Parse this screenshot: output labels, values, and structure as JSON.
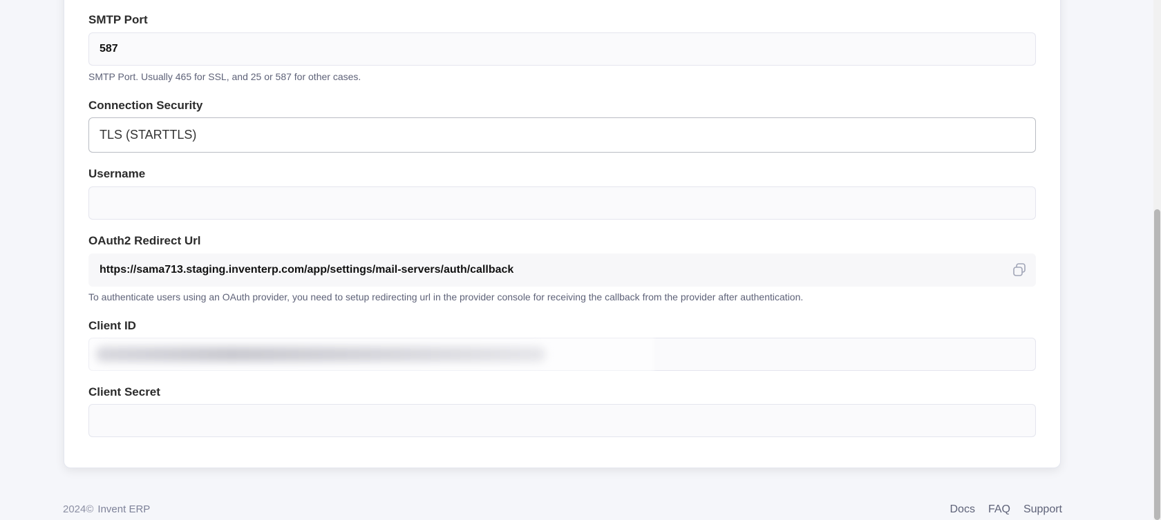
{
  "form": {
    "smtp_port": {
      "label": "SMTP Port",
      "value": "587",
      "help": "SMTP Port. Usually 465 for SSL, and 25 or 587 for other cases."
    },
    "connection_security": {
      "label": "Connection Security",
      "value": "TLS (STARTTLS)"
    },
    "username": {
      "label": "Username",
      "value": ""
    },
    "oauth_redirect": {
      "label": "OAuth2 Redirect Url",
      "value": "https://sama713.staging.inventerp.com/app/settings/mail-servers/auth/callback",
      "help": "To authenticate users using an OAuth provider, you need to setup redirecting url in the provider console for receiving the callback from the provider after authentication.",
      "icon": "copy-icon"
    },
    "client_id": {
      "label": "Client ID",
      "value": ""
    },
    "client_secret": {
      "label": "Client Secret",
      "value": ""
    }
  },
  "footer": {
    "copyright": "2024©",
    "brand": "Invent ERP",
    "links": [
      "Docs",
      "FAQ",
      "Support"
    ]
  }
}
